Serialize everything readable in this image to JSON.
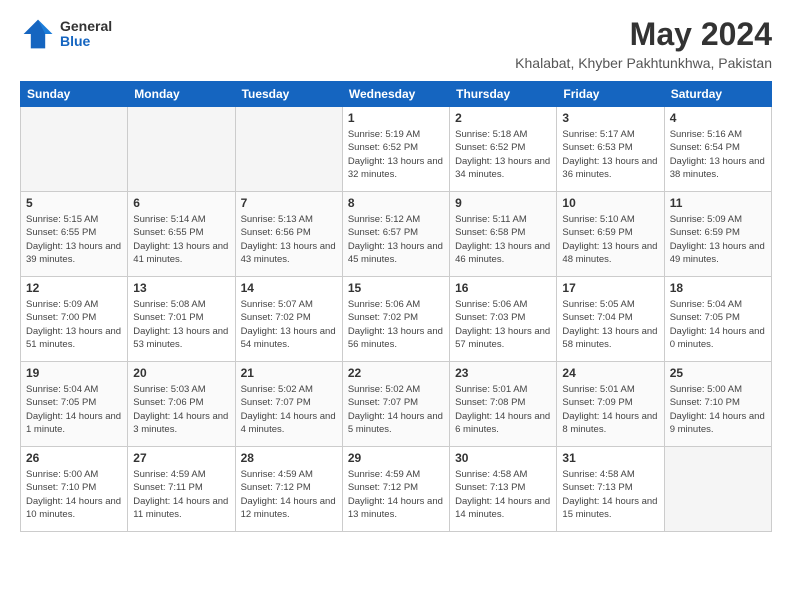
{
  "header": {
    "logo": {
      "general": "General",
      "blue": "Blue"
    },
    "title": "May 2024",
    "location": "Khalabat, Khyber Pakhtunkhwa, Pakistan"
  },
  "days_of_week": [
    "Sunday",
    "Monday",
    "Tuesday",
    "Wednesday",
    "Thursday",
    "Friday",
    "Saturday"
  ],
  "weeks": [
    [
      {
        "day": "",
        "empty": true
      },
      {
        "day": "",
        "empty": true
      },
      {
        "day": "",
        "empty": true
      },
      {
        "day": "1",
        "sunrise": "Sunrise: 5:19 AM",
        "sunset": "Sunset: 6:52 PM",
        "daylight": "Daylight: 13 hours and 32 minutes."
      },
      {
        "day": "2",
        "sunrise": "Sunrise: 5:18 AM",
        "sunset": "Sunset: 6:52 PM",
        "daylight": "Daylight: 13 hours and 34 minutes."
      },
      {
        "day": "3",
        "sunrise": "Sunrise: 5:17 AM",
        "sunset": "Sunset: 6:53 PM",
        "daylight": "Daylight: 13 hours and 36 minutes."
      },
      {
        "day": "4",
        "sunrise": "Sunrise: 5:16 AM",
        "sunset": "Sunset: 6:54 PM",
        "daylight": "Daylight: 13 hours and 38 minutes."
      }
    ],
    [
      {
        "day": "5",
        "sunrise": "Sunrise: 5:15 AM",
        "sunset": "Sunset: 6:55 PM",
        "daylight": "Daylight: 13 hours and 39 minutes."
      },
      {
        "day": "6",
        "sunrise": "Sunrise: 5:14 AM",
        "sunset": "Sunset: 6:55 PM",
        "daylight": "Daylight: 13 hours and 41 minutes."
      },
      {
        "day": "7",
        "sunrise": "Sunrise: 5:13 AM",
        "sunset": "Sunset: 6:56 PM",
        "daylight": "Daylight: 13 hours and 43 minutes."
      },
      {
        "day": "8",
        "sunrise": "Sunrise: 5:12 AM",
        "sunset": "Sunset: 6:57 PM",
        "daylight": "Daylight: 13 hours and 45 minutes."
      },
      {
        "day": "9",
        "sunrise": "Sunrise: 5:11 AM",
        "sunset": "Sunset: 6:58 PM",
        "daylight": "Daylight: 13 hours and 46 minutes."
      },
      {
        "day": "10",
        "sunrise": "Sunrise: 5:10 AM",
        "sunset": "Sunset: 6:59 PM",
        "daylight": "Daylight: 13 hours and 48 minutes."
      },
      {
        "day": "11",
        "sunrise": "Sunrise: 5:09 AM",
        "sunset": "Sunset: 6:59 PM",
        "daylight": "Daylight: 13 hours and 49 minutes."
      }
    ],
    [
      {
        "day": "12",
        "sunrise": "Sunrise: 5:09 AM",
        "sunset": "Sunset: 7:00 PM",
        "daylight": "Daylight: 13 hours and 51 minutes."
      },
      {
        "day": "13",
        "sunrise": "Sunrise: 5:08 AM",
        "sunset": "Sunset: 7:01 PM",
        "daylight": "Daylight: 13 hours and 53 minutes."
      },
      {
        "day": "14",
        "sunrise": "Sunrise: 5:07 AM",
        "sunset": "Sunset: 7:02 PM",
        "daylight": "Daylight: 13 hours and 54 minutes."
      },
      {
        "day": "15",
        "sunrise": "Sunrise: 5:06 AM",
        "sunset": "Sunset: 7:02 PM",
        "daylight": "Daylight: 13 hours and 56 minutes."
      },
      {
        "day": "16",
        "sunrise": "Sunrise: 5:06 AM",
        "sunset": "Sunset: 7:03 PM",
        "daylight": "Daylight: 13 hours and 57 minutes."
      },
      {
        "day": "17",
        "sunrise": "Sunrise: 5:05 AM",
        "sunset": "Sunset: 7:04 PM",
        "daylight": "Daylight: 13 hours and 58 minutes."
      },
      {
        "day": "18",
        "sunrise": "Sunrise: 5:04 AM",
        "sunset": "Sunset: 7:05 PM",
        "daylight": "Daylight: 14 hours and 0 minutes."
      }
    ],
    [
      {
        "day": "19",
        "sunrise": "Sunrise: 5:04 AM",
        "sunset": "Sunset: 7:05 PM",
        "daylight": "Daylight: 14 hours and 1 minute."
      },
      {
        "day": "20",
        "sunrise": "Sunrise: 5:03 AM",
        "sunset": "Sunset: 7:06 PM",
        "daylight": "Daylight: 14 hours and 3 minutes."
      },
      {
        "day": "21",
        "sunrise": "Sunrise: 5:02 AM",
        "sunset": "Sunset: 7:07 PM",
        "daylight": "Daylight: 14 hours and 4 minutes."
      },
      {
        "day": "22",
        "sunrise": "Sunrise: 5:02 AM",
        "sunset": "Sunset: 7:07 PM",
        "daylight": "Daylight: 14 hours and 5 minutes."
      },
      {
        "day": "23",
        "sunrise": "Sunrise: 5:01 AM",
        "sunset": "Sunset: 7:08 PM",
        "daylight": "Daylight: 14 hours and 6 minutes."
      },
      {
        "day": "24",
        "sunrise": "Sunrise: 5:01 AM",
        "sunset": "Sunset: 7:09 PM",
        "daylight": "Daylight: 14 hours and 8 minutes."
      },
      {
        "day": "25",
        "sunrise": "Sunrise: 5:00 AM",
        "sunset": "Sunset: 7:10 PM",
        "daylight": "Daylight: 14 hours and 9 minutes."
      }
    ],
    [
      {
        "day": "26",
        "sunrise": "Sunrise: 5:00 AM",
        "sunset": "Sunset: 7:10 PM",
        "daylight": "Daylight: 14 hours and 10 minutes."
      },
      {
        "day": "27",
        "sunrise": "Sunrise: 4:59 AM",
        "sunset": "Sunset: 7:11 PM",
        "daylight": "Daylight: 14 hours and 11 minutes."
      },
      {
        "day": "28",
        "sunrise": "Sunrise: 4:59 AM",
        "sunset": "Sunset: 7:12 PM",
        "daylight": "Daylight: 14 hours and 12 minutes."
      },
      {
        "day": "29",
        "sunrise": "Sunrise: 4:59 AM",
        "sunset": "Sunset: 7:12 PM",
        "daylight": "Daylight: 14 hours and 13 minutes."
      },
      {
        "day": "30",
        "sunrise": "Sunrise: 4:58 AM",
        "sunset": "Sunset: 7:13 PM",
        "daylight": "Daylight: 14 hours and 14 minutes."
      },
      {
        "day": "31",
        "sunrise": "Sunrise: 4:58 AM",
        "sunset": "Sunset: 7:13 PM",
        "daylight": "Daylight: 14 hours and 15 minutes."
      },
      {
        "day": "",
        "empty": true
      }
    ]
  ]
}
